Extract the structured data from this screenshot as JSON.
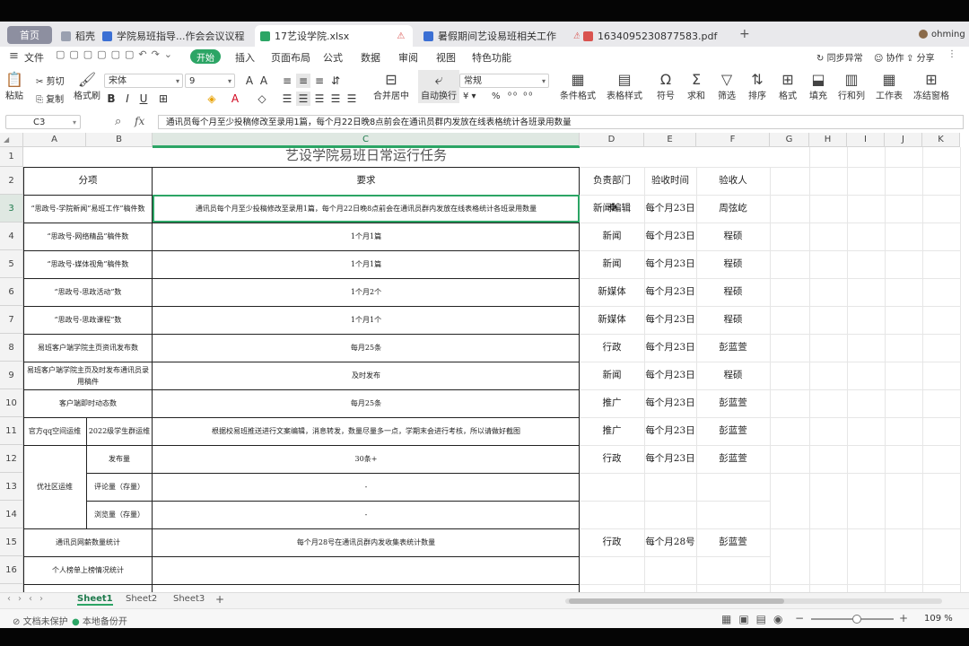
{
  "tabs": {
    "home": "首页",
    "items": [
      {
        "label": "稻壳"
      },
      {
        "label": "学院易班指导...作会会议议程"
      },
      {
        "label": "17艺设学院.xlsx"
      },
      {
        "label": "暑假期间艺设易班相关工作"
      },
      {
        "label": "1634095230877583.pdf"
      }
    ],
    "add": "+",
    "user": "ohming"
  },
  "menu": {
    "file": "文件",
    "start": "开始",
    "items": [
      "插入",
      "页面布局",
      "公式",
      "数据",
      "审阅",
      "视图",
      "特色功能"
    ],
    "sync": "同步异常",
    "collab": "协作",
    "share": "分享"
  },
  "ribbon": {
    "paste": "粘贴",
    "cut": "剪切",
    "copy": "复制",
    "format_painter": "格式刷",
    "font_name": "宋体",
    "font_size": "9",
    "merge": "合并居中",
    "wrap": "自动换行",
    "number_format": "常规",
    "yen": "¥",
    "percent": "%",
    "cond_format": "条件格式",
    "table_style": "表格样式",
    "symbol": "符号",
    "sum": "求和",
    "filter": "筛选",
    "sort": "排序",
    "format": "格式",
    "fill": "填充",
    "rowcol": "行和列",
    "worksheet": "工作表",
    "freeze": "冻结窗格"
  },
  "formula_bar": {
    "cell_ref": "C3",
    "fx": "fx",
    "content": "通讯员每个月至少投稿修改至录用1篇，每个月22日晚8点前会在通讯员群内发放在线表格统计各班录用数量"
  },
  "columns": [
    "A",
    "B",
    "C",
    "D",
    "E",
    "F",
    "G",
    "H",
    "I",
    "J",
    "K"
  ],
  "rows": [
    "1",
    "2",
    "3",
    "4",
    "5",
    "6",
    "7",
    "8",
    "9",
    "10",
    "11",
    "12",
    "13",
    "14",
    "15",
    "16"
  ],
  "sheet": {
    "title": "艺设学院易班日常运行任务",
    "header": {
      "item": "分项",
      "req": "要求",
      "dept": "负责部门",
      "time": "验收时间",
      "checker": "验收人"
    },
    "r3": {
      "a": "“思政号-学院新闻”易班工作”稿件数",
      "c": "通讯员每个月至少投稿修改至录用1篇，每个月22日晚8点前会在通讯员群内发放在线表格统计各班录用数量",
      "d": "新闻编辑",
      "e": "每个月23日",
      "f": "周弦屹"
    },
    "r4": {
      "a": "“思政号-网络精品”稿件数",
      "c": "1个月1篇",
      "d": "新闻",
      "e": "每个月23日",
      "f": "程硕"
    },
    "r5": {
      "a": "“思政号-媒体视角”稿件数",
      "c": "1个月1篇",
      "d": "新闻",
      "e": "每个月23日",
      "f": "程硕"
    },
    "r6": {
      "a": "“思政号-思政活动”数",
      "c": "1个月2个",
      "d": "新媒体",
      "e": "每个月23日",
      "f": "程硕"
    },
    "r7": {
      "a": "“思政号-思政课程”数",
      "c": "1个月1个",
      "d": "新媒体",
      "e": "每个月23日",
      "f": "程硕"
    },
    "r8": {
      "a": "易班客户端学院主页资讯发布数",
      "c": "每月25条",
      "d": "行政",
      "e": "每个月23日",
      "f": "彭蓝萱"
    },
    "r9": {
      "a": "易班客户端学院主页及时发布通讯员录用稿件",
      "c": "及时发布",
      "d": "新闻",
      "e": "每个月23日",
      "f": "程硕"
    },
    "r10": {
      "a": "客户端即时动态数",
      "c": "每月25条",
      "d": "推广",
      "e": "每个月23日",
      "f": "彭蓝萱"
    },
    "r11": {
      "a": "官方qq空间运维",
      "b": "2022级学生群运维",
      "c": "根据校易班推送进行文案编辑，消息转发，数量尽量多一点，学期末会进行考核，所以请做好截图",
      "d": "推广",
      "e": "每个月23日",
      "f": "彭蓝萱"
    },
    "r12": {
      "a": "优社区运维",
      "b": "发布量",
      "c": "30条+",
      "d": "行政",
      "e": "每个月23日",
      "f": "彭蓝萱"
    },
    "r13": {
      "b": "评论量（存量）",
      "c": "-"
    },
    "r14": {
      "b": "浏览量（存量）",
      "c": "-"
    },
    "r15": {
      "a": "通讯员网薪数量统计",
      "c": "每个月28号在通讯员群内发收集表统计数量",
      "d": "行政",
      "e": "每个月28号",
      "f": "彭蓝萱"
    },
    "r16": {
      "a": "个人榜单上榜情况统计"
    }
  },
  "sheet_tabs": [
    "Sheet1",
    "Sheet2",
    "Sheet3"
  ],
  "status": {
    "protect": "文档未保护",
    "backup": "本地备份开",
    "zoom": "109 %"
  },
  "colors": {
    "accent": "#2ca565",
    "selection": "#1e7a4c"
  }
}
